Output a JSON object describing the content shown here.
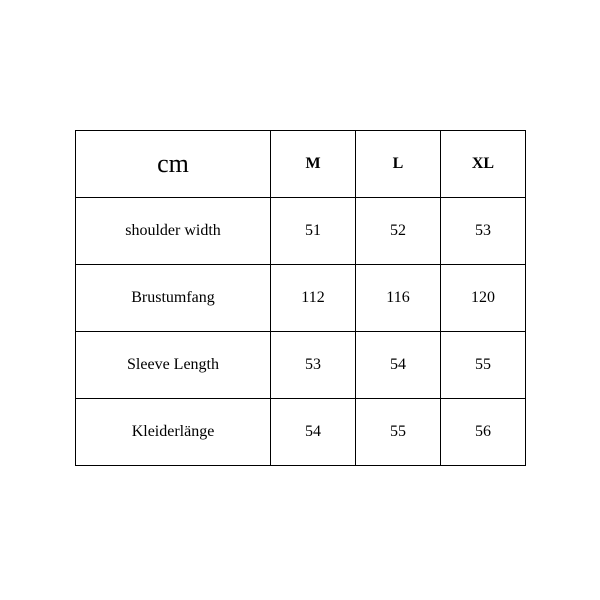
{
  "chart_data": {
    "type": "table",
    "unit": "cm",
    "sizes": [
      "M",
      "L",
      "XL"
    ],
    "rows": [
      {
        "label": "shoulder width",
        "values": [
          51,
          52,
          53
        ]
      },
      {
        "label": "Brustumfang",
        "values": [
          112,
          116,
          120
        ]
      },
      {
        "label": "Sleeve Length",
        "values": [
          53,
          54,
          55
        ]
      },
      {
        "label": "Kleiderlänge",
        "values": [
          54,
          55,
          56
        ]
      }
    ]
  }
}
